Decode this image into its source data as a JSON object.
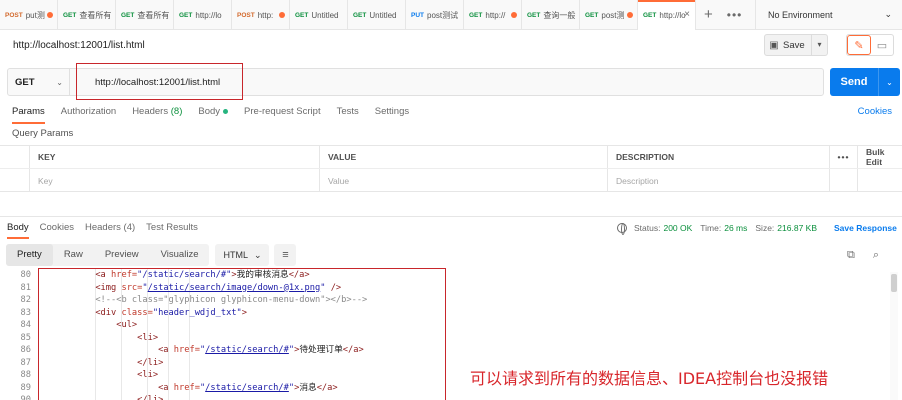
{
  "tabs": [
    {
      "method": "POST",
      "method_color": "#d3692c",
      "title": "put测",
      "dot": true,
      "active": false
    },
    {
      "method": "GET",
      "method_color": "#0a8f3c",
      "title": "查看所有",
      "dot": false,
      "active": false
    },
    {
      "method": "GET",
      "method_color": "#0a8f3c",
      "title": "查看所有",
      "dot": false,
      "active": false
    },
    {
      "method": "GET",
      "method_color": "#0a8f3c",
      "title": "http://lo",
      "dot": false,
      "active": false
    },
    {
      "method": "POST",
      "method_color": "#d3692c",
      "title": "http:",
      "dot": true,
      "active": false
    },
    {
      "method": "GET",
      "method_color": "#0a8f3c",
      "title": "Untitled",
      "dot": false,
      "active": false
    },
    {
      "method": "GET",
      "method_color": "#0a8f3c",
      "title": "Untitled",
      "dot": false,
      "active": false
    },
    {
      "method": "PUT",
      "method_color": "#097bed",
      "title": "post测试",
      "dot": false,
      "active": false
    },
    {
      "method": "GET",
      "method_color": "#0a8f3c",
      "title": "http://",
      "dot": true,
      "active": false
    },
    {
      "method": "GET",
      "method_color": "#0a8f3c",
      "title": "查询一般",
      "dot": false,
      "active": false
    },
    {
      "method": "GET",
      "method_color": "#0a8f3c",
      "title": "post测",
      "dot": true,
      "active": false
    },
    {
      "method": "GET",
      "method_color": "#0a8f3c",
      "title": "http://lo",
      "dot": false,
      "active": true
    }
  ],
  "tab_icons": {
    "new_tab": "+",
    "more": "•••",
    "close": "×"
  },
  "environment": {
    "label": "No Environment",
    "chevron": "⌄"
  },
  "request": {
    "title": "http://localhost:12001/list.html",
    "method": "GET",
    "url": "http://localhost:12001/list.html",
    "save_label": "Save",
    "send_label": "Send"
  },
  "request_tabs": [
    {
      "label": "Params",
      "active": true
    },
    {
      "label": "Authorization"
    },
    {
      "label": "Headers",
      "count": "(8)"
    },
    {
      "label": "Body",
      "dot": true
    },
    {
      "label": "Pre-request Script"
    },
    {
      "label": "Tests"
    },
    {
      "label": "Settings"
    }
  ],
  "cookies_label": "Cookies",
  "query_params_label": "Query Params",
  "params_table": {
    "headers": [
      "KEY",
      "VALUE",
      "DESCRIPTION"
    ],
    "bulk_edit": "Bulk Edit",
    "placeholders": [
      "Key",
      "Value",
      "Description"
    ]
  },
  "response": {
    "tabs": [
      {
        "label": "Body",
        "active": true
      },
      {
        "label": "Cookies"
      },
      {
        "label": "Headers",
        "count": "(4)"
      },
      {
        "label": "Test Results"
      }
    ],
    "status_label": "Status:",
    "status_value": "200 OK",
    "time_label": "Time:",
    "time_value": "26 ms",
    "size_label": "Size:",
    "size_value": "216.87 KB",
    "save_response": "Save Response",
    "view_modes": [
      "Pretty",
      "Raw",
      "Preview",
      "Visualize"
    ],
    "active_view": "Pretty",
    "format": "HTML"
  },
  "code_lines": [
    {
      "n": "80",
      "indent": 10,
      "segs": [
        [
          "tg",
          "<a "
        ],
        [
          "at",
          "href="
        ],
        [
          "str",
          "\"/static/search/#\""
        ],
        [
          "tg",
          ">"
        ],
        [
          "tx",
          "我的审核消息"
        ],
        [
          "tg",
          "</a>"
        ]
      ]
    },
    {
      "n": "81",
      "indent": 10,
      "segs": [
        [
          "tg",
          "<img "
        ],
        [
          "at",
          "src="
        ],
        [
          "str",
          "\""
        ],
        [
          "lnk",
          "/static/search/image/down-@1x.png"
        ],
        [
          "str",
          "\""
        ],
        [
          "tg",
          " />"
        ]
      ]
    },
    {
      "n": "82",
      "indent": 10,
      "segs": [
        [
          "cm",
          "<!--<b class=\"glyphicon glyphicon-menu-down\"></b>-->"
        ]
      ]
    },
    {
      "n": "83",
      "indent": 10,
      "segs": [
        [
          "tg",
          "<div "
        ],
        [
          "at",
          "class="
        ],
        [
          "str",
          "\"header_wdjd_txt\""
        ],
        [
          "tg",
          ">"
        ]
      ]
    },
    {
      "n": "84",
      "indent": 14,
      "segs": [
        [
          "tg",
          "<ul>"
        ]
      ]
    },
    {
      "n": "85",
      "indent": 18,
      "segs": [
        [
          "tg",
          "<li>"
        ]
      ]
    },
    {
      "n": "86",
      "indent": 22,
      "segs": [
        [
          "tg",
          "<a "
        ],
        [
          "at",
          "href="
        ],
        [
          "str",
          "\""
        ],
        [
          "lnk",
          "/static/search/#"
        ],
        [
          "str",
          "\""
        ],
        [
          "tg",
          ">"
        ],
        [
          "tx",
          "待处理订单"
        ],
        [
          "tg",
          "</a>"
        ]
      ]
    },
    {
      "n": "87",
      "indent": 18,
      "segs": [
        [
          "tg",
          "</li>"
        ]
      ]
    },
    {
      "n": "88",
      "indent": 18,
      "segs": [
        [
          "tg",
          "<li>"
        ]
      ]
    },
    {
      "n": "89",
      "indent": 22,
      "segs": [
        [
          "tg",
          "<a "
        ],
        [
          "at",
          "href="
        ],
        [
          "str",
          "\""
        ],
        [
          "lnk",
          "/static/search/#"
        ],
        [
          "str",
          "\""
        ],
        [
          "tg",
          ">"
        ],
        [
          "tx",
          "消息"
        ],
        [
          "tg",
          "</a>"
        ]
      ]
    },
    {
      "n": "90",
      "indent": 18,
      "segs": [
        [
          "tg",
          "</li>"
        ]
      ]
    }
  ],
  "annotation": "可以请求到所有的数据信息、IDEA控制台也没报错",
  "colors": {
    "accent": "#ff6c37",
    "send": "#097bed",
    "highlight_box": "#c8262b",
    "status_ok": "#0a8f3c"
  }
}
